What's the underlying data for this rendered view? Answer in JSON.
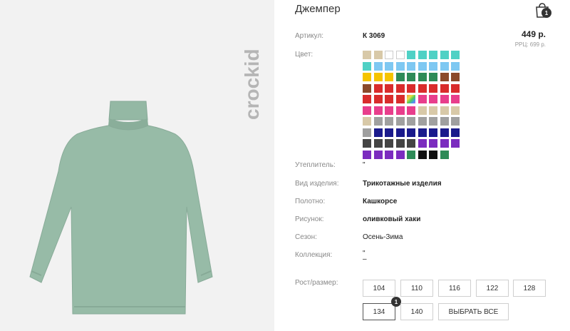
{
  "product": {
    "title": "Джемпер",
    "brand_logo_text": "crockid",
    "image": "turtleneck sweater"
  },
  "cart": {
    "icon": "shopping-bag-icon",
    "count": "1"
  },
  "price": {
    "value": "449 р.",
    "rrp": "PPЦ: 699 р."
  },
  "details": {
    "article_label": "Артикул:",
    "article_value": "К 3069",
    "color_label": "Цвет:",
    "insulation_label": "Утеплитель:",
    "insulation_value": "\"",
    "type_label": "Вид изделия:",
    "type_value": "Трикотажные изделия",
    "fabric_label": "Полотно:",
    "fabric_value": "Кашкорсе",
    "pattern_label": "Рисунок:",
    "pattern_value": "оливковый хаки",
    "season_label": "Сезон:",
    "season_value": "Осень-Зима",
    "collection_label": "Коллекция:",
    "collection_value": "\"",
    "collection_value_2": "–"
  },
  "colors": {
    "selected_index": 95,
    "rows": [
      [
        "#d8c9a8",
        "#d8c9a8",
        "#ffffff",
        "#ffffff",
        "#4fd1c5",
        "#4fd1c5",
        "#4fd1c5",
        "#4fd1c5",
        "#4fd1c5"
      ],
      [
        "#4fd1c5",
        "#7ec8f2",
        "#7ec8f2",
        "#7ec8f2",
        "#7ec8f2",
        "#7ec8f2",
        "#7ec8f2",
        "#7ec8f2",
        "#7ec8f2"
      ],
      [
        "#f5c400",
        "#f5c400",
        "#f5c400",
        "#2e8b57",
        "#2e8b57",
        "#2e8b57",
        "#2e8b57",
        "#8b4a2b",
        "#8b4a2b"
      ],
      [
        "#8b4a2b",
        "#d92c2c",
        "#d92c2c",
        "#d92c2c",
        "#d92c2c",
        "#d92c2c",
        "#d92c2c",
        "#d92c2c",
        "#d92c2c"
      ],
      [
        "#d92c2c",
        "#d92c2c",
        "#d92c2c",
        "#d92c2c",
        "multi",
        "#e83e8c",
        "#e83e8c",
        "#e83e8c",
        "#e83e8c"
      ],
      [
        "#e83e8c",
        "#e83e8c",
        "#e83e8c",
        "#e83e8c",
        "#e83e8c",
        "#d8c9a8",
        "#d8c9a8",
        "#d8c9a8",
        "#d8c9a8"
      ],
      [
        "#d8c9a8",
        "#a0a0a0",
        "#a0a0a0",
        "#a0a0a0",
        "#a0a0a0",
        "#a0a0a0",
        "#a0a0a0",
        "#a0a0a0",
        "#a0a0a0"
      ],
      [
        "#a0a0a0",
        "#1a1a8c",
        "#1a1a8c",
        "#1a1a8c",
        "#1a1a8c",
        "#1a1a8c",
        "#1a1a8c",
        "#1a1a8c",
        "#1a1a8c"
      ],
      [
        "#444444",
        "#444444",
        "#444444",
        "#444444",
        "#444444",
        "#7b2cbf",
        "#7b2cbf",
        "#7b2cbf",
        "#7b2cbf"
      ],
      [
        "#7b2cbf",
        "#7b2cbf",
        "#7b2cbf",
        "#7b2cbf",
        "#2e8b57",
        "#111111",
        "#111111",
        "#2e8b57"
      ]
    ]
  },
  "sizes": {
    "label": "Рост/размер:",
    "items": [
      "104",
      "110",
      "116",
      "122",
      "128",
      "134",
      "140"
    ],
    "select_all": "ВЫБРАТЬ ВСЕ",
    "active": "134",
    "active_count": "1"
  }
}
